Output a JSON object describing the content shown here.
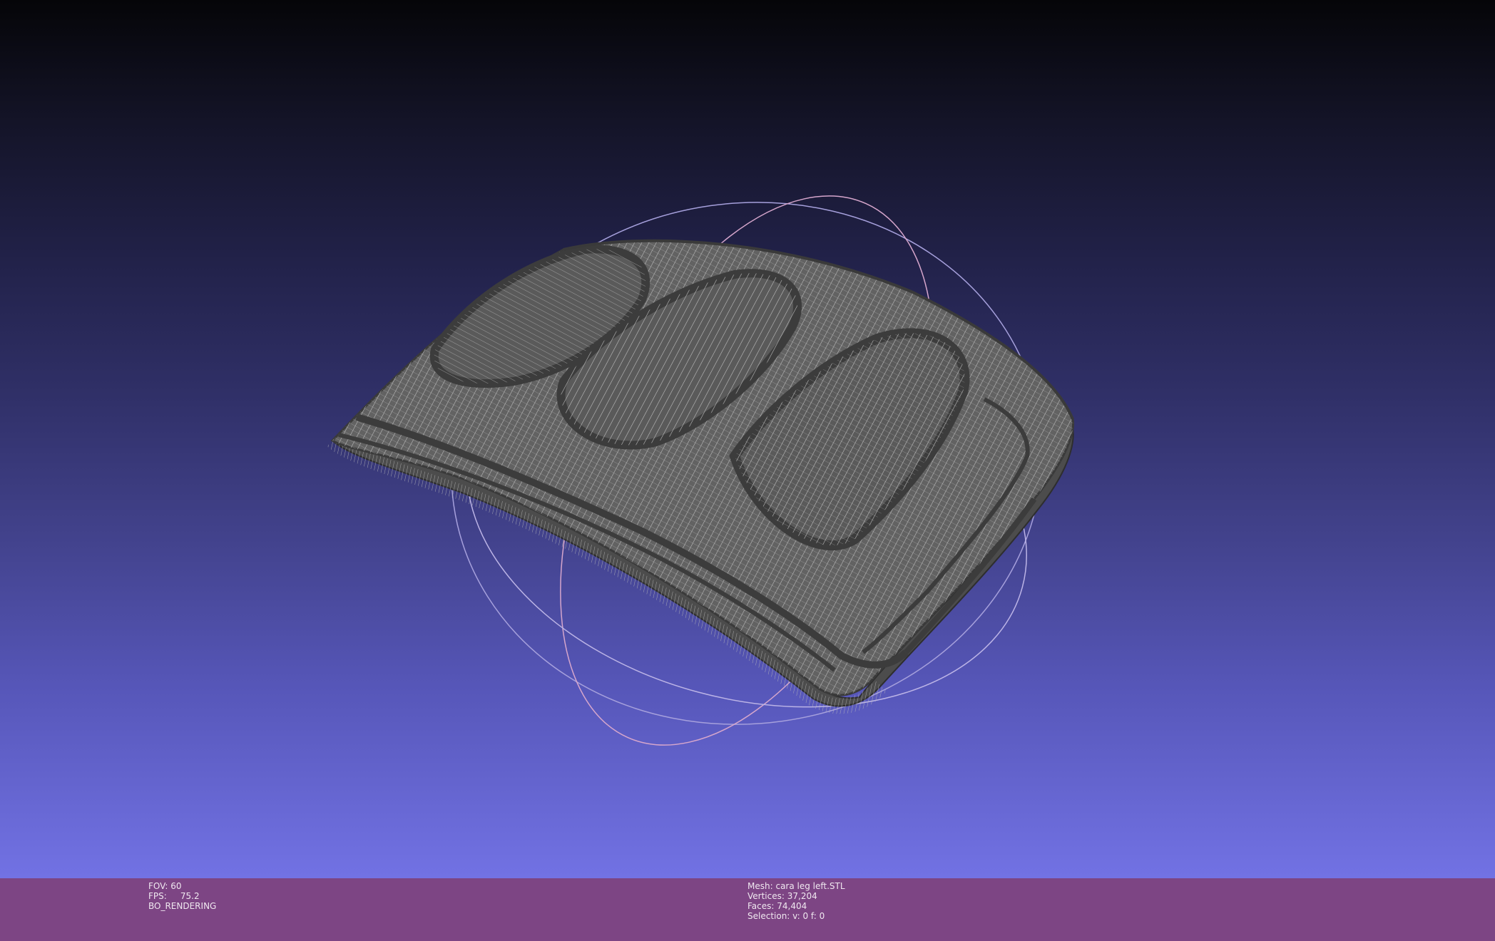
{
  "viewport": {
    "gradient_top": "#050508",
    "gradient_bottom": "#7272e4",
    "mesh_color": "#5a5a5a",
    "wire_color": "#d8d8d8",
    "trackball_colors": [
      "#c8a0c8",
      "#a0a0e0",
      "#d0b0d8"
    ]
  },
  "status_bar": {
    "background": "#7d4584",
    "left_info": {
      "fov_label": "FOV:",
      "fov_value": "60",
      "fps_label": "FPS:",
      "fps_value": "75.2",
      "render_mode": "BO_RENDERING"
    },
    "mesh_info": {
      "mesh_label": "Mesh:",
      "mesh_name": "cara leg left.STL",
      "vertices_label": "Vertices:",
      "vertices_value": "37,204",
      "faces_label": "Faces:",
      "faces_value": "74,404",
      "selection_label": "Selection:",
      "selection_value": "v: 0 f: 0"
    }
  }
}
